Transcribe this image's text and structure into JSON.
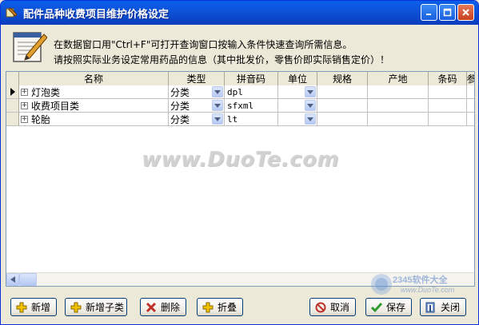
{
  "window": {
    "title": "配件品种收费项目维护价格设定",
    "buttons": {
      "minimize": "_",
      "maximize": "□",
      "close": "✕"
    }
  },
  "info": {
    "line1": "在数据窗口用\"Ctrl+F\"可打开查询窗口按输入条件快速查询所需信息。",
    "line2": "请按照实际业务设定常用药品的信息（其中批发价，零售价即实际销售定价）！"
  },
  "grid": {
    "columns": [
      "名称",
      "类型",
      "拼音码",
      "单位",
      "规格",
      "产地",
      "条码",
      "参"
    ],
    "rows": [
      {
        "name": "灯泡类",
        "type": "分类",
        "pinyin": "dpl",
        "unit": "",
        "current": true
      },
      {
        "name": "收费项目类",
        "type": "分类",
        "pinyin": "sfxml",
        "unit": "",
        "current": false
      },
      {
        "name": "轮胎",
        "type": "分类",
        "pinyin": "lt",
        "unit": "",
        "current": false
      }
    ]
  },
  "watermark": "www.DuoTe.com",
  "corner_logo": {
    "text": "2345软件大全",
    "url": "www.DuoTe.com"
  },
  "buttons": {
    "add": "新增",
    "add_child": "新增子类",
    "delete": "删除",
    "collapse": "折叠",
    "cancel": "取消",
    "save": "保存",
    "close": "关闭"
  },
  "colors": {
    "title_bar": "#0d52d7",
    "window_bg": "#ece9d8",
    "add_icon": "#e6b800",
    "delete_icon": "#c0302a",
    "cancel_icon": "#c0302a",
    "save_icon": "#2f9a2f"
  }
}
